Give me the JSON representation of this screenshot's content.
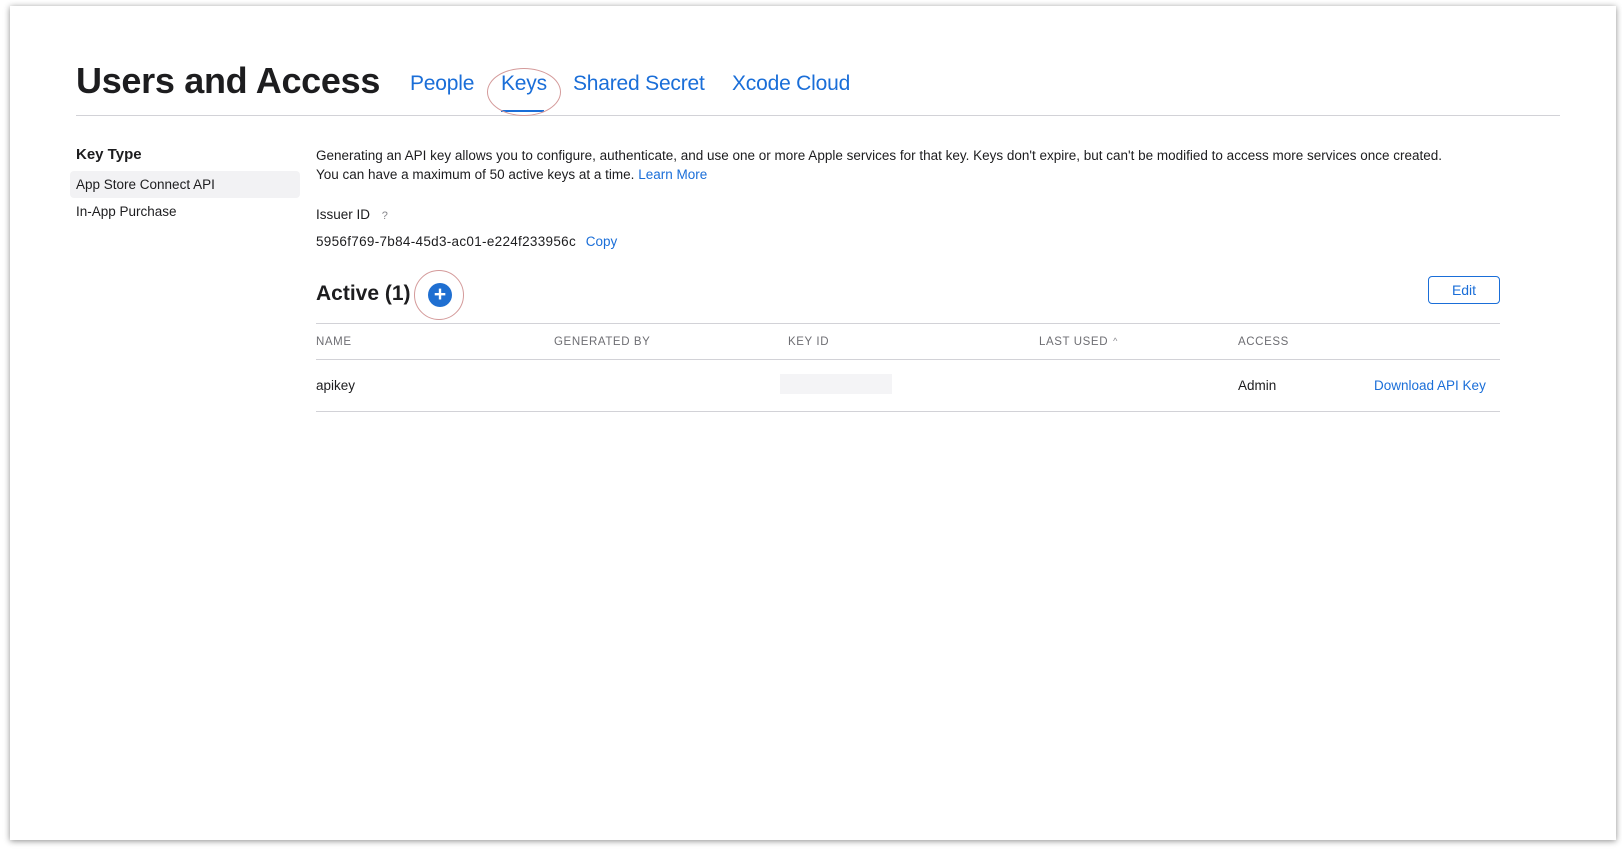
{
  "header": {
    "title": "Users and Access",
    "tabs": [
      {
        "label": "People"
      },
      {
        "label": "Keys"
      },
      {
        "label": "Shared Secret"
      },
      {
        "label": "Xcode Cloud"
      }
    ],
    "active_tab": "Keys"
  },
  "sidebar": {
    "heading": "Key Type",
    "items": [
      {
        "label": "App Store Connect API",
        "selected": true
      },
      {
        "label": "In-App Purchase",
        "selected": false
      }
    ]
  },
  "main": {
    "description_line1": "Generating an API key allows you to configure, authenticate, and use one or more Apple services for that key. Keys don't expire, but can't be modified to access more services once created.",
    "description_line2": "You can have a maximum of 50 active keys at a time.",
    "learn_more": "Learn More",
    "issuer": {
      "label": "Issuer ID",
      "help": "?",
      "value": "5956f769-7b84-45d3-ac01-e224f233956c",
      "copy": "Copy"
    },
    "active": {
      "heading": "Active (1)",
      "add": "+",
      "edit": "Edit"
    },
    "table": {
      "columns": [
        "NAME",
        "GENERATED BY",
        "KEY ID",
        "LAST USED",
        "ACCESS"
      ],
      "sort_indicator": "^",
      "rows": [
        {
          "name": "apikey",
          "generated_by": "",
          "key_id": "",
          "last_used": "",
          "access": "Admin",
          "action": "Download API Key"
        }
      ]
    }
  },
  "colors": {
    "accent": "#1a6ed8",
    "add_button": "#1f6fd1",
    "annotation": "#d49a9a",
    "divider": "#d2d2d7",
    "selected_bg": "#f2f2f4"
  },
  "icons": {
    "help": "question-mark-icon",
    "add": "plus-circle-icon",
    "sort": "chevron-up-icon"
  }
}
